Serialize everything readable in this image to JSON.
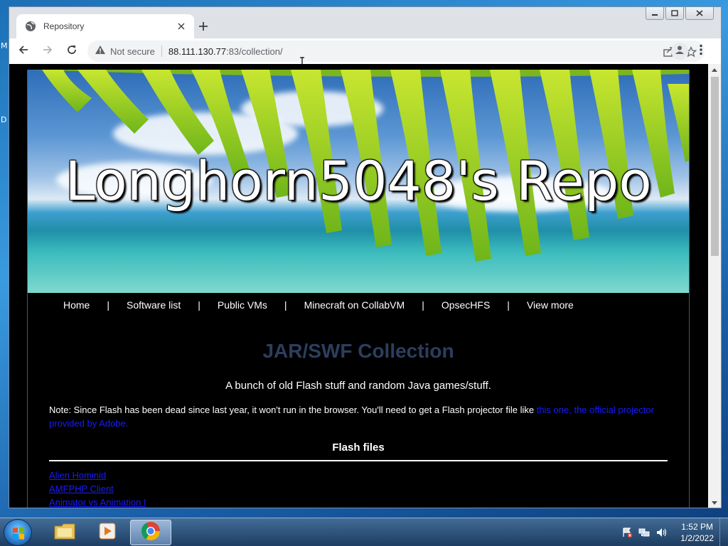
{
  "desktop": {
    "edge_letters": [
      "M",
      "D"
    ]
  },
  "browser": {
    "tab": {
      "title": "Repository"
    },
    "address_bar": {
      "security_label": "Not secure",
      "url_host": "88.111.130.77",
      "url_rest": ":83/collection/"
    },
    "icons": {
      "back": "back-arrow-icon",
      "forward": "forward-arrow-icon",
      "reload": "reload-icon",
      "share": "share-icon",
      "bookmark": "star-icon",
      "profile": "profile-icon",
      "menu": "kebab-menu-icon"
    }
  },
  "site": {
    "banner_title": "Longhorn5048's Repo",
    "nav": [
      {
        "label": "Home"
      },
      {
        "label": "Software list"
      },
      {
        "label": "Public VMs"
      },
      {
        "label": "Minecraft on CollabVM"
      },
      {
        "label": "OpsecHFS"
      },
      {
        "label": "View more"
      }
    ],
    "nav_separator": "|",
    "section_title": "JAR/SWF Collection",
    "subtitle": "A bunch of old Flash stuff and random Java games/stuff.",
    "note_text": "Note: Since Flash has been dead since last year, it won't run in the browser. You'll need to get a Flash projector file like ",
    "note_link": "this one, the official projector provided by Adobe.",
    "flash_heading": "Flash files",
    "flash_files": [
      {
        "name": "Alien Hominid"
      },
      {
        "name": "AMFPHP Client"
      },
      {
        "name": "Animator vs Animation I"
      }
    ]
  },
  "taskbar": {
    "pinned": [
      "windows-explorer",
      "media-player",
      "chrome"
    ],
    "clock_time": "1:52 PM",
    "clock_date": "1/2/2022"
  },
  "colors": {
    "section_title": "#2c3e5e",
    "link": "#1a1aff",
    "page_background": "#000000"
  }
}
